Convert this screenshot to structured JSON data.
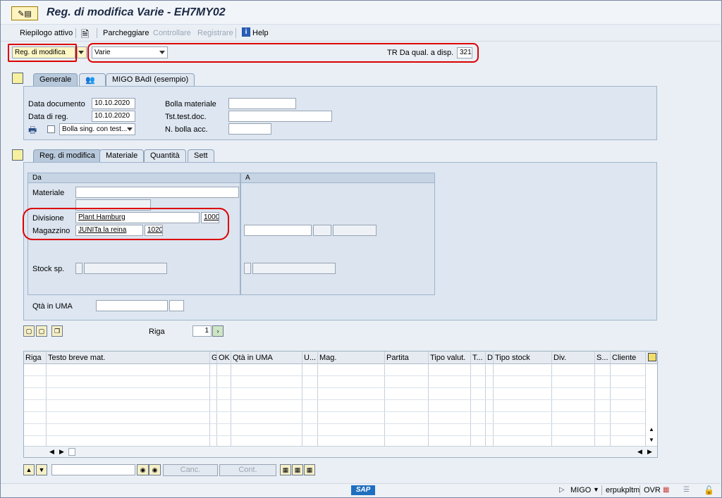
{
  "window": {
    "title": "Reg. di modifica Varie - EH7MY02",
    "app_icon": "migo-icon"
  },
  "toolbar": {
    "summary": "Riepilogo attivo",
    "park": "Parcheggiare",
    "check": "Controllare",
    "post": "Registrare",
    "help": "Help"
  },
  "header": {
    "transaction_select": "Reg. di modifica",
    "ref_select": "Varie",
    "movement_label": "TR Da qual. a disp.",
    "movement_value": "321"
  },
  "tabs_top": [
    "Generale",
    "MIGO BAdI (esempio)"
  ],
  "general": {
    "doc_date_label": "Data documento",
    "doc_date": "10.10.2020",
    "post_date_label": "Data di reg.",
    "post_date": "10.10.2020",
    "bill_label": "Bolla materiale",
    "header_text_label": "Tst.test.doc.",
    "bill_acc_label": "N. bolla acc.",
    "print_option": "Bolla sing. con test..."
  },
  "tabs_item": [
    "Reg. di modifica",
    "Materiale",
    "Quantità",
    "Sett"
  ],
  "transfer": {
    "from_label": "Da",
    "to_label": "A",
    "material_label": "Materiale",
    "plant_label": "Divisione",
    "plant_name": "Plant Hamburg",
    "plant_code": "1000",
    "sloc_label": "Magazzino",
    "sloc_name": "JUNITa la reina",
    "sloc_code": "1020",
    "stock_label": "Stock sp.",
    "qty_label": "Qtà in UMA"
  },
  "line": {
    "label": "Riga",
    "value": "1"
  },
  "grid": {
    "columns": [
      "Riga",
      "Testo breve mat.",
      "G",
      "OK",
      "Qtà in UMA",
      "U...",
      "Mag.",
      "Partita",
      "Tipo valut.",
      "T...",
      "D",
      "Tipo stock",
      "Div.",
      "S...",
      "Cliente"
    ]
  },
  "bottom": {
    "delete": "Canc.",
    "contents": "Cont."
  },
  "status": {
    "tcode": "MIGO",
    "server": "erpukpltm",
    "mode": "OVR",
    "logo": "SAP"
  }
}
